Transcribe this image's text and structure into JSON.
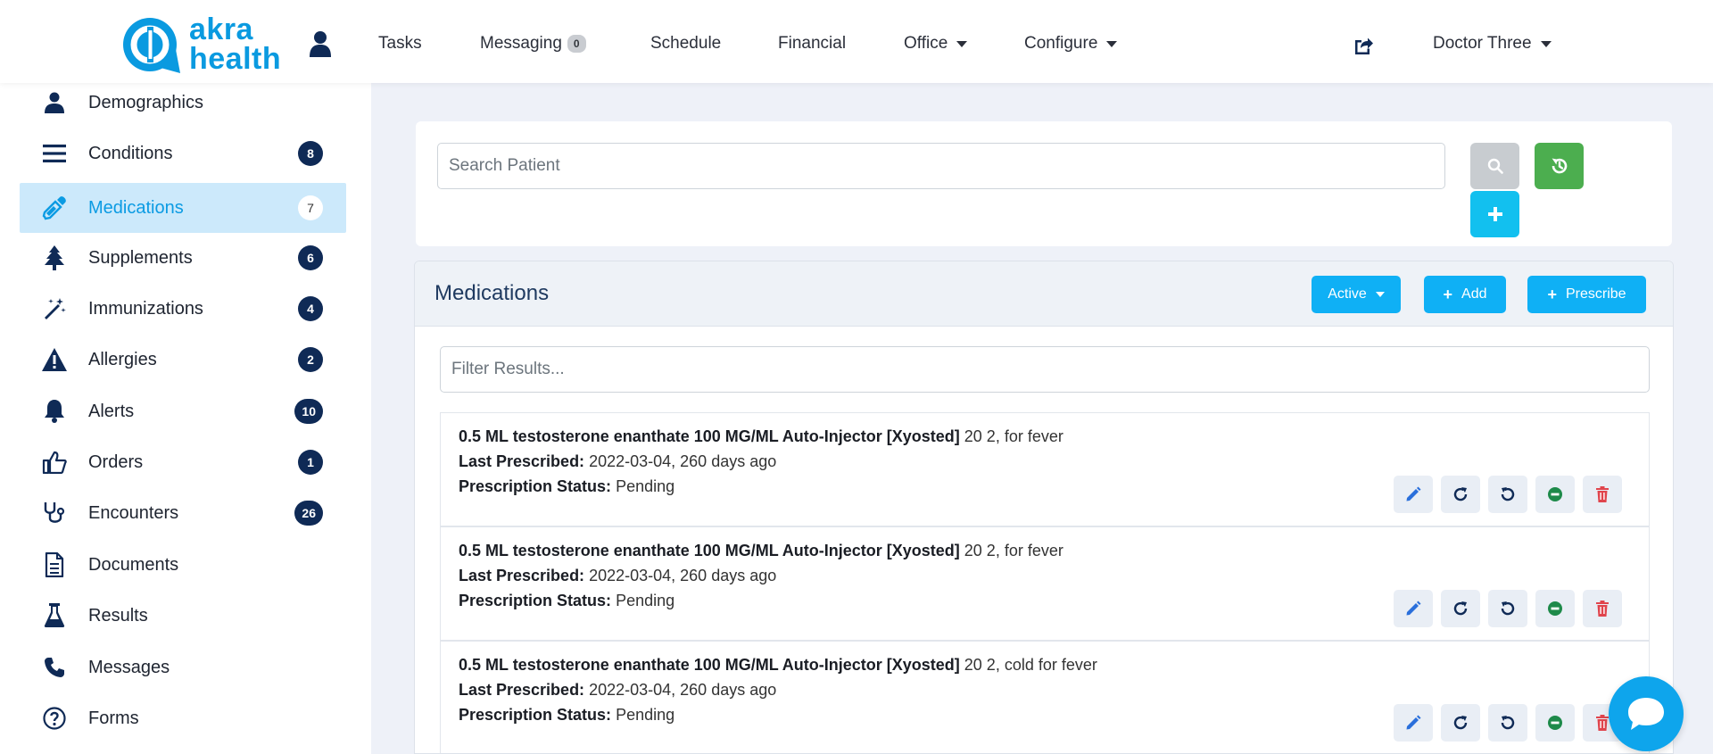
{
  "brand": {
    "line1": "akra",
    "line2": "health",
    "color": "#0a9ae0"
  },
  "nav": {
    "tasks": "Tasks",
    "messaging": "Messaging",
    "messaging_count": "0",
    "schedule": "Schedule",
    "financial": "Financial",
    "office": "Office",
    "configure": "Configure",
    "user": "Doctor Three"
  },
  "sidebar": {
    "items": [
      {
        "label": "Demographics",
        "icon": "user-icon",
        "badge": ""
      },
      {
        "label": "Conditions",
        "icon": "list-icon",
        "badge": "8"
      },
      {
        "label": "Medications",
        "icon": "eyedropper-icon",
        "badge": "7",
        "active": true
      },
      {
        "label": "Supplements",
        "icon": "tree-icon",
        "badge": "6"
      },
      {
        "label": "Immunizations",
        "icon": "magic-wand-icon",
        "badge": "4"
      },
      {
        "label": "Allergies",
        "icon": "warning-icon",
        "badge": "2"
      },
      {
        "label": "Alerts",
        "icon": "bell-icon",
        "badge": "10"
      },
      {
        "label": "Orders",
        "icon": "thumbs-up-icon",
        "badge": "1"
      },
      {
        "label": "Encounters",
        "icon": "stethoscope-icon",
        "badge": "26"
      },
      {
        "label": "Documents",
        "icon": "document-icon",
        "badge": ""
      },
      {
        "label": "Results",
        "icon": "flask-icon",
        "badge": ""
      },
      {
        "label": "Messages",
        "icon": "phone-icon",
        "badge": ""
      },
      {
        "label": "Forms",
        "icon": "question-circle-icon",
        "badge": ""
      }
    ]
  },
  "search": {
    "placeholder": "Search Patient"
  },
  "medications": {
    "title": "Medications",
    "status_filter": "Active",
    "add_label": "Add",
    "prescribe_label": "Prescribe",
    "filter_placeholder": "Filter Results...",
    "last_prescribed_label": "Last Prescribed:",
    "status_label": "Prescription Status:",
    "rows": [
      {
        "name": "0.5 ML testosterone enanthate 100 MG/ML Auto-Injector [Xyosted]",
        "extra": "20 2, for fever",
        "last_prescribed": "2022-03-04, 260 days ago",
        "status": "Pending"
      },
      {
        "name": "0.5 ML testosterone enanthate 100 MG/ML Auto-Injector [Xyosted]",
        "extra": "20 2, for fever",
        "last_prescribed": "2022-03-04, 260 days ago",
        "status": "Pending"
      },
      {
        "name": "0.5 ML testosterone enanthate 100 MG/ML Auto-Injector [Xyosted]",
        "extra": "20 2, cold for fever",
        "last_prescribed": "2022-03-04, 260 days ago",
        "status": "Pending"
      }
    ]
  },
  "colors": {
    "accent": "#0fb0f5",
    "navy_badge": "#0f2a56",
    "active_bg": "#cce9fb",
    "green": "#4cae4f",
    "danger": "#e0444c"
  }
}
